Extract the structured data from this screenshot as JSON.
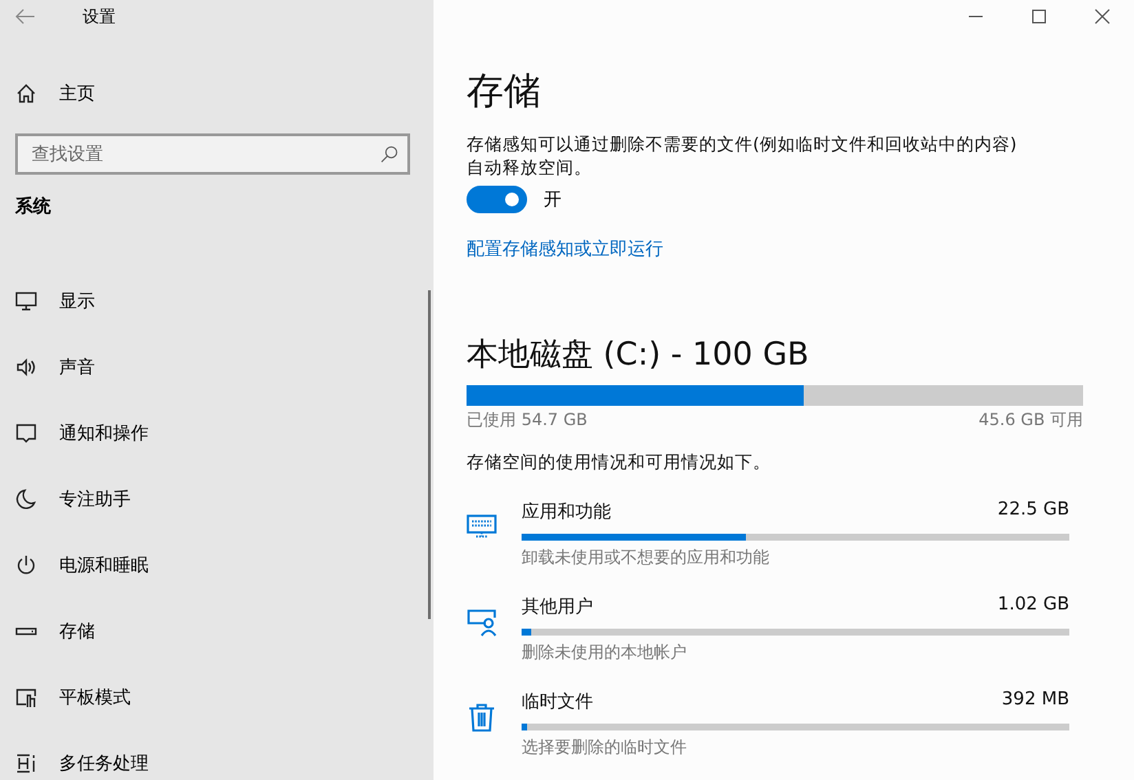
{
  "window": {
    "title": "设置"
  },
  "sidebar": {
    "home": "主页",
    "search": {
      "placeholder": "查找设置"
    },
    "section": "系统",
    "items": [
      {
        "label": "显示"
      },
      {
        "label": "声音"
      },
      {
        "label": "通知和操作"
      },
      {
        "label": "专注助手"
      },
      {
        "label": "电源和睡眠"
      },
      {
        "label": "存储"
      },
      {
        "label": "平板模式"
      },
      {
        "label": "多任务处理"
      }
    ]
  },
  "page": {
    "title": "存储",
    "description": "存储感知可以通过删除不需要的文件(例如临时文件和回收站中的内容)自动释放空间。",
    "toggle": {
      "on": true,
      "label": "开"
    },
    "link": "配置存储感知或立即运行",
    "disk": {
      "title": "本地磁盘 (C:) - 100 GB",
      "level": 0.547,
      "used": "已使用 54.7 GB",
      "free": "45.6 GB 可用"
    },
    "summary": "存储空间的使用情况和可用情况如下。",
    "categories": [
      {
        "name": "应用和功能",
        "size": "22.5 GB",
        "level": 0.41,
        "hint": "卸载未使用或不想要的应用和功能"
      },
      {
        "name": "其他用户",
        "size": "1.02 GB",
        "level": 0.018,
        "hint": "删除未使用的本地帐户"
      },
      {
        "name": "临时文件",
        "size": "392 MB",
        "level": 0.008,
        "hint": "选择要删除的临时文件"
      }
    ]
  }
}
